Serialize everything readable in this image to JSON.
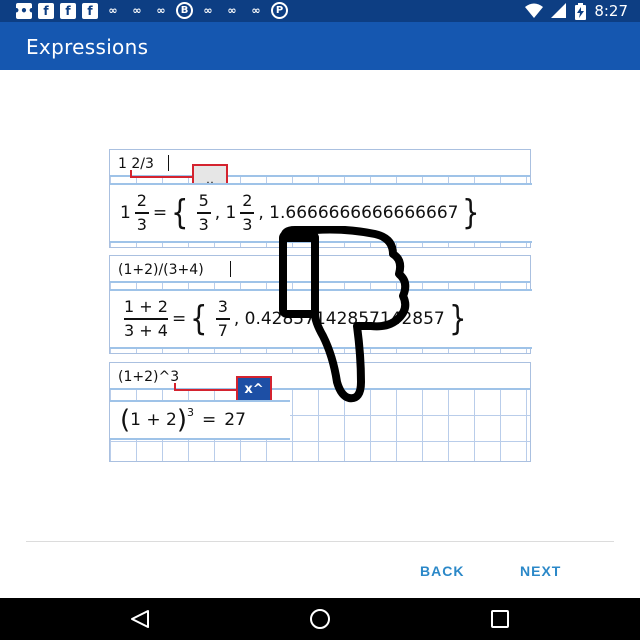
{
  "status_bar": {
    "time": "8:27",
    "left_icons": [
      "chat-icon",
      "facebook-icon",
      "facebook-icon",
      "facebook-icon",
      "link-icon",
      "link-icon",
      "link-icon",
      "b-app-icon",
      "link-icon",
      "link-icon",
      "link-icon",
      "pinterest-icon"
    ],
    "right_icons": [
      "wifi-icon",
      "signal-icon",
      "battery-charging-icon"
    ],
    "glyphs": {
      "chat": "•••",
      "facebook": "f",
      "link": "∞",
      "b_app": "B",
      "pinterest": "P"
    }
  },
  "app_bar": {
    "title": "Expressions",
    "background": "#1557b0"
  },
  "tutorial": {
    "examples": [
      {
        "input": "1 2/3",
        "key_label": "⎵",
        "result": {
          "whole": "1",
          "frac_num": "2",
          "frac_den": "3",
          "equals": "=",
          "alt1_num": "5",
          "alt1_den": "3",
          "alt2_whole": "1",
          "alt2_num": "2",
          "alt2_den": "3",
          "decimal": "1.6666666666666667"
        }
      },
      {
        "input": "(1+2)/(3+4)",
        "result": {
          "num": "1 + 2",
          "den": "3 + 4",
          "equals": "=",
          "alt1_num": "3",
          "alt1_den": "7",
          "decimal": "0.42857142857142857"
        }
      },
      {
        "input": "(1+2)^3",
        "key_label": "x^",
        "result": {
          "base": "1 + 2",
          "exponent": "3",
          "equals": "=",
          "value": "27"
        }
      }
    ]
  },
  "buttons": {
    "back": "BACK",
    "next": "NEXT"
  },
  "nav_bar": {
    "icons": [
      "back-icon",
      "home-icon",
      "recents-icon"
    ]
  },
  "colors": {
    "status_bar": "#0d3e83",
    "accent": "#2b88c8",
    "callout_red": "#d4232f"
  }
}
